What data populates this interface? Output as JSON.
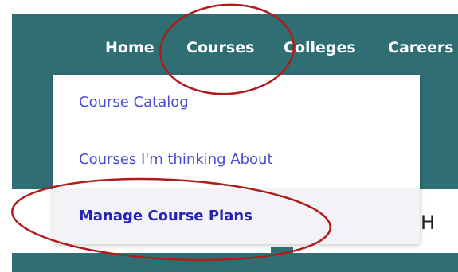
{
  "nav": {
    "items": [
      {
        "label": "Home"
      },
      {
        "label": "Courses"
      },
      {
        "label": "Colleges"
      },
      {
        "label": "Careers"
      }
    ]
  },
  "dropdown": {
    "items": [
      {
        "label": "Course Catalog"
      },
      {
        "label": "Courses I'm thinking About"
      },
      {
        "label": "Manage Course Plans"
      }
    ]
  },
  "page": {
    "partial_heading_letter": "H"
  },
  "colors": {
    "header_teal": "#2f6f73",
    "menu_link": "#4b4bd6",
    "annotation_red": "#b01c1c"
  }
}
